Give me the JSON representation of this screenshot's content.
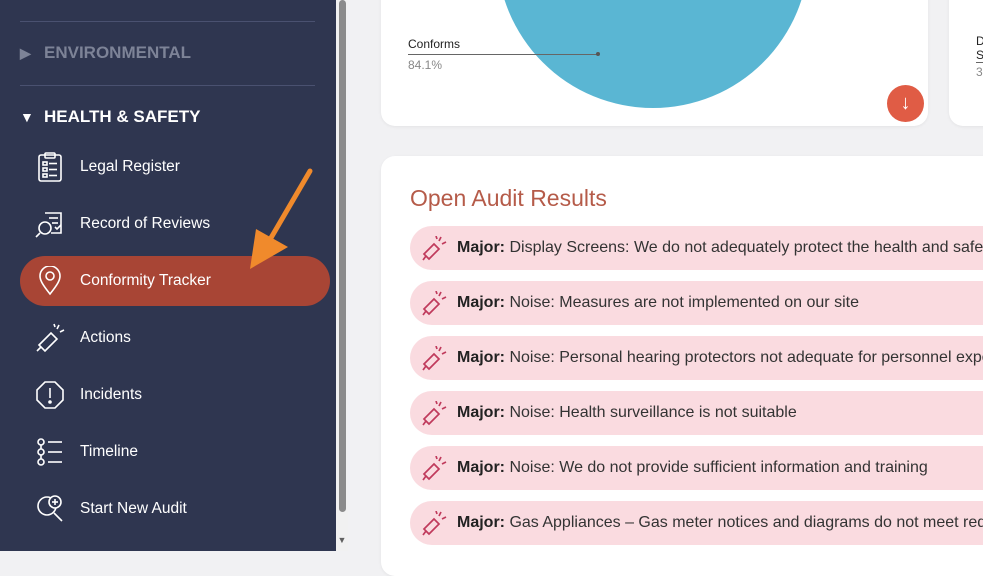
{
  "sidebar": {
    "sections": [
      {
        "label": "ENVIRONMENTAL",
        "expanded": false
      },
      {
        "label": "HEALTH & SAFETY",
        "expanded": true
      }
    ],
    "items": [
      {
        "label": "Legal Register",
        "icon": "clipboard-list-icon"
      },
      {
        "label": "Record of Reviews",
        "icon": "review-search-icon"
      },
      {
        "label": "Conformity Tracker",
        "icon": "map-pin-icon",
        "active": true
      },
      {
        "label": "Actions",
        "icon": "megaphone-icon"
      },
      {
        "label": "Incidents",
        "icon": "alert-octagon-icon"
      },
      {
        "label": "Timeline",
        "icon": "timeline-list-icon"
      },
      {
        "label": "Start New Audit",
        "icon": "search-plus-icon"
      }
    ]
  },
  "chart_card": {
    "chart_data": {
      "type": "pie",
      "slices": [
        {
          "label": "Conforms",
          "value": 84.1
        }
      ],
      "labels": [
        {
          "name": "Conforms",
          "percent": "84.1%"
        }
      ]
    },
    "download_icon": "arrow-down-icon"
  },
  "second_card": {
    "text_lines": [
      "D",
      "S",
      "3"
    ]
  },
  "audit": {
    "title": "Open Audit Results",
    "items": [
      {
        "severity": "Major:",
        "text": "Display Screens: We do not adequately protect the health and safety of our staff"
      },
      {
        "severity": "Major:",
        "text": "Noise: Measures are not implemented on our site"
      },
      {
        "severity": "Major:",
        "text": "Noise: Personal hearing protectors not adequate for personnel exposed"
      },
      {
        "severity": "Major:",
        "text": "Noise: Health surveillance is not suitable"
      },
      {
        "severity": "Major:",
        "text": "Noise: We do not provide sufficient information and training"
      },
      {
        "severity": "Major:",
        "text": "Gas Appliances – Gas meter notices and diagrams do not meet requirements"
      }
    ]
  },
  "colors": {
    "sidebar_bg": "#2f3650",
    "active_item": "#a84535",
    "pie": "#5ab6d3",
    "audit_item_bg": "#fadbe0",
    "audit_title": "#b55b49",
    "annotation_arrow": "#f08a2c"
  }
}
